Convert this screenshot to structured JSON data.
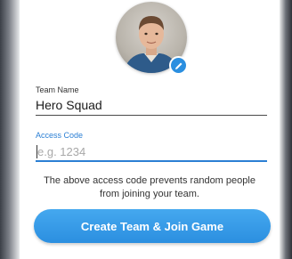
{
  "profile": {
    "avatar_alt": "user-photo",
    "edit_icon": "pencil-icon"
  },
  "form": {
    "team_name_label": "Team Name",
    "team_name_value": "Hero Squad",
    "access_code_label": "Access Code",
    "access_code_placeholder": "e.g. 1234",
    "access_code_value": "",
    "help_text": "The above access code prevents random people from joining your team."
  },
  "actions": {
    "create_label": "Create Team & Join Game"
  },
  "colors": {
    "accent": "#2b8fe0",
    "label_active": "#2b7fd4",
    "text": "#1a1a1a"
  }
}
